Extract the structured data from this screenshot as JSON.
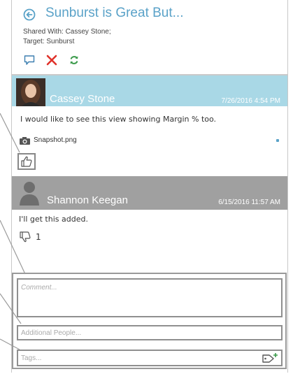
{
  "header": {
    "title": "Sunburst is Great But...",
    "shared_with": "Shared With: Cassey Stone;",
    "target": "Target: Sunburst",
    "toolbar": {
      "comment_icon": "speech-bubble-icon",
      "delete_icon": "red-x-icon",
      "refresh_icon": "green-refresh-icon"
    }
  },
  "comments": [
    {
      "author": "Cassey Stone",
      "date": "7/26/2016 4:54 PM",
      "text": "I would like to see this view showing Margin % too.",
      "attachment": "Snapshot.png",
      "reaction_icon": "thumbs-up-icon"
    },
    {
      "author": "Shannon Keegan",
      "date": "6/15/2016 11:57 AM",
      "text": "I'll get this added.",
      "reaction_icon": "thumbs-down-icon",
      "reaction_count": "1"
    }
  ],
  "form": {
    "comment_placeholder": "Comment...",
    "people_placeholder": "Additional People...",
    "tags_placeholder": "Tags..."
  },
  "colors": {
    "title_blue": "#5aa2c8",
    "comment1_header": "#a9d8e6",
    "comment2_header": "#a0a0a0",
    "delete_red": "#e0322b",
    "refresh_green": "#3a9a4a"
  }
}
